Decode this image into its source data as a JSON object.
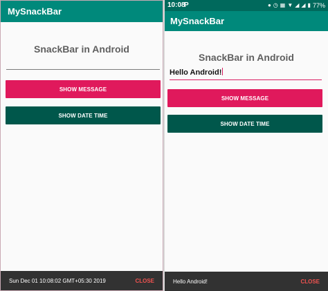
{
  "left": {
    "app_title": "MySnackBar",
    "heading": "SnackBar in Android",
    "input_value": "",
    "show_message_label": "SHOW MESSAGE",
    "show_date_time_label": "SHOW DATE TIME",
    "snackbar_text": "Sun Dec 01 10:08:02 GMT+05:30 2019",
    "snackbar_action": "CLOSE"
  },
  "right": {
    "status_time": "10:08",
    "status_app_icon": "P",
    "battery_percent": "77%",
    "status_icons": [
      "notification-icon",
      "alarm-icon",
      "vibrate-icon",
      "wifi-icon",
      "signal-icon",
      "signal-icon",
      "battery-icon"
    ],
    "app_title": "MySnackBar",
    "heading": "SnackBar in Android",
    "input_value": "Hello Android!",
    "show_message_label": "SHOW MESSAGE",
    "show_date_time_label": "SHOW DATE TIME",
    "snackbar_text": "Hello Android!",
    "snackbar_action": "CLOSE"
  },
  "colors": {
    "app_bar": "#00897b",
    "status_bar": "#00695c",
    "pink_button": "#e0195c",
    "teal_button": "#00574b",
    "snackbar_bg": "#323232",
    "snackbar_action": "#ef5350"
  }
}
